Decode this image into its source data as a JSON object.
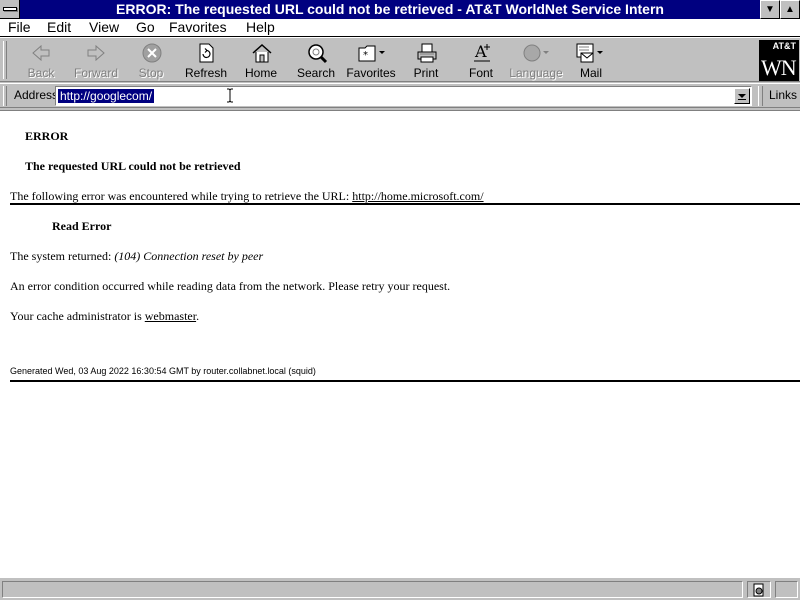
{
  "window": {
    "title": "ERROR: The requested URL could not be retrieved - AT&T WorldNet Service Intern",
    "scroll_up_glyph": "▼",
    "maximize_glyph": "▲"
  },
  "menu": {
    "file": "File",
    "edit": "Edit",
    "view": "View",
    "go": "Go",
    "favorites": "Favorites",
    "help": "Help"
  },
  "toolbar": {
    "back": "Back",
    "forward": "Forward",
    "stop": "Stop",
    "refresh": "Refresh",
    "home": "Home",
    "search": "Search",
    "favorites": "Favorites",
    "print": "Print",
    "font": "Font",
    "language": "Language",
    "mail": "Mail"
  },
  "logo": {
    "brand": "AT&T",
    "mark": "WN"
  },
  "address": {
    "label": "Address",
    "value": "http://googlecom/",
    "links_label": "Links"
  },
  "page": {
    "heading": "ERROR",
    "subheading": "The requested URL could not be retrieved",
    "error_intro": "The following error was encountered while trying to retrieve the URL: ",
    "url": "http://home.microsoft.com/",
    "read_error": "Read Error",
    "system_returned": "The system returned: ",
    "system_message": "(104) Connection reset by peer",
    "condition": "An error condition occurred while reading data from the network. Please retry your request.",
    "cache_admin": "Your cache administrator is ",
    "webmaster": "webmaster",
    "period": ".",
    "generated": "Generated Wed, 03 Aug 2022 16:30:54 GMT by router.collabnet.local (squid)"
  },
  "colors": {
    "title_bar": "#000080",
    "chrome": "#c0c0c0",
    "selection": "#000080"
  }
}
